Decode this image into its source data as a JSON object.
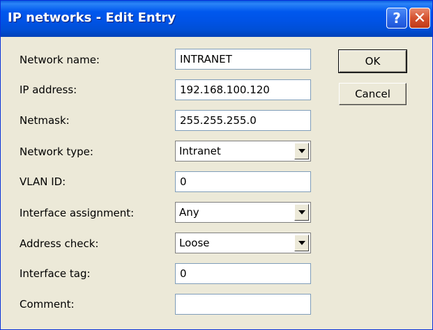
{
  "window": {
    "title": "IP networks - Edit Entry",
    "help_symbol": "?",
    "close_symbol": "✕"
  },
  "form": {
    "network_name": {
      "label": "Network name:",
      "value": "INTRANET"
    },
    "ip_address": {
      "label": "IP address:",
      "value": "192.168.100.120"
    },
    "netmask": {
      "label": "Netmask:",
      "value": "255.255.255.0"
    },
    "network_type": {
      "label": "Network type:",
      "value": "Intranet"
    },
    "vlan_id": {
      "label": "VLAN ID:",
      "value": "0"
    },
    "interface_assignment": {
      "label": "Interface assignment:",
      "value": "Any"
    },
    "address_check": {
      "label": "Address check:",
      "value": "Loose"
    },
    "interface_tag": {
      "label": "Interface tag:",
      "value": "0"
    },
    "comment": {
      "label": "Comment:",
      "value": ""
    }
  },
  "buttons": {
    "ok": "OK",
    "cancel": "Cancel"
  },
  "colors": {
    "titlebar": "#0054E3",
    "dialog_background": "#ECE9D8",
    "close_button": "#D5522F"
  },
  "icons": {
    "help": "question-mark-icon",
    "close": "close-x-icon",
    "dropdown": "chevron-down-icon"
  }
}
